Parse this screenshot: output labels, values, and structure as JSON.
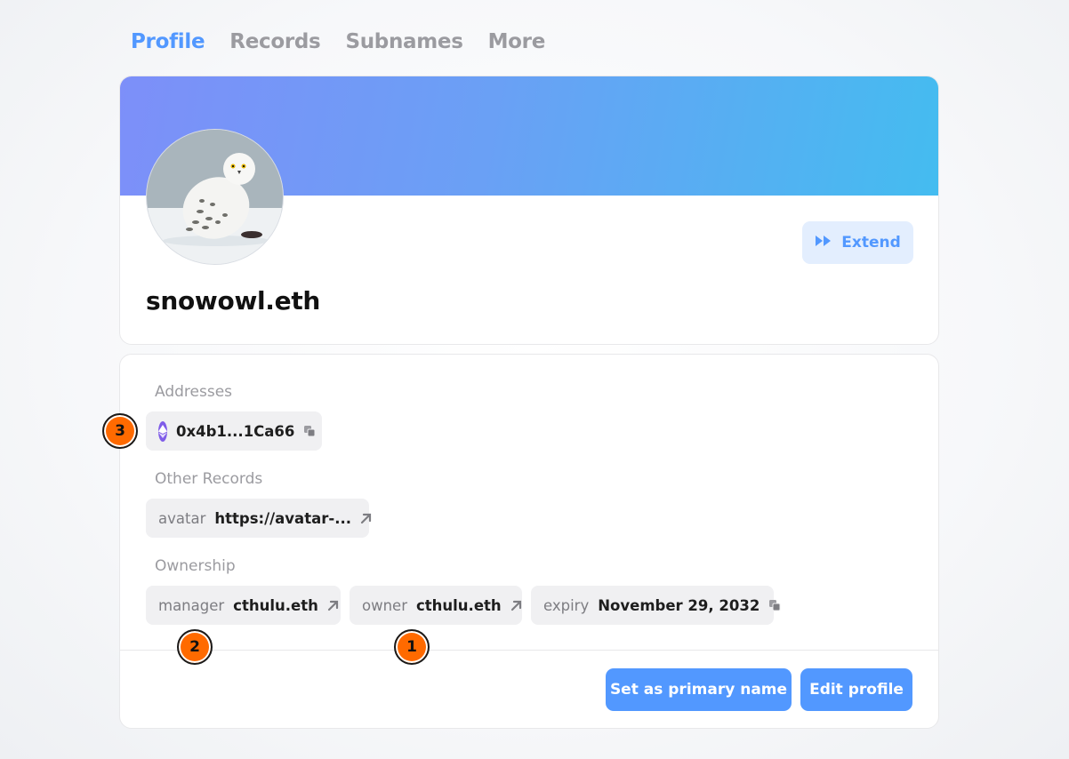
{
  "tabs": [
    {
      "label": "Profile",
      "active": true
    },
    {
      "label": "Records",
      "active": false
    },
    {
      "label": "Subnames",
      "active": false
    },
    {
      "label": "More",
      "active": false
    }
  ],
  "profile": {
    "name": "snowowl.eth",
    "extend_label": "Extend",
    "banner_colors": [
      "#7d8ff9",
      "#44bcf0"
    ]
  },
  "addresses": {
    "label": "Addresses",
    "eth": {
      "value": "0x4b1...1Ca66",
      "icon": "ethereum-icon",
      "action_icon": "copy-icon"
    }
  },
  "other_records": {
    "label": "Other Records",
    "avatar": {
      "key": "avatar",
      "value": "https://avatar-...",
      "action_icon": "external-link-icon"
    }
  },
  "ownership": {
    "label": "Ownership",
    "manager": {
      "key": "manager",
      "value": "cthulu.eth",
      "action_icon": "external-link-icon"
    },
    "owner": {
      "key": "owner",
      "value": "cthulu.eth",
      "action_icon": "external-link-icon"
    },
    "expiry": {
      "key": "expiry",
      "value": "November 29, 2032",
      "action_icon": "copy-icon"
    }
  },
  "actions": {
    "set_primary_label": "Set as primary name",
    "edit_profile_label": "Edit profile"
  },
  "markers": [
    "1",
    "2",
    "3"
  ],
  "colors": {
    "accent": "#5298ff",
    "marker": "#ff6a00",
    "eth": "#7f5ce8"
  }
}
